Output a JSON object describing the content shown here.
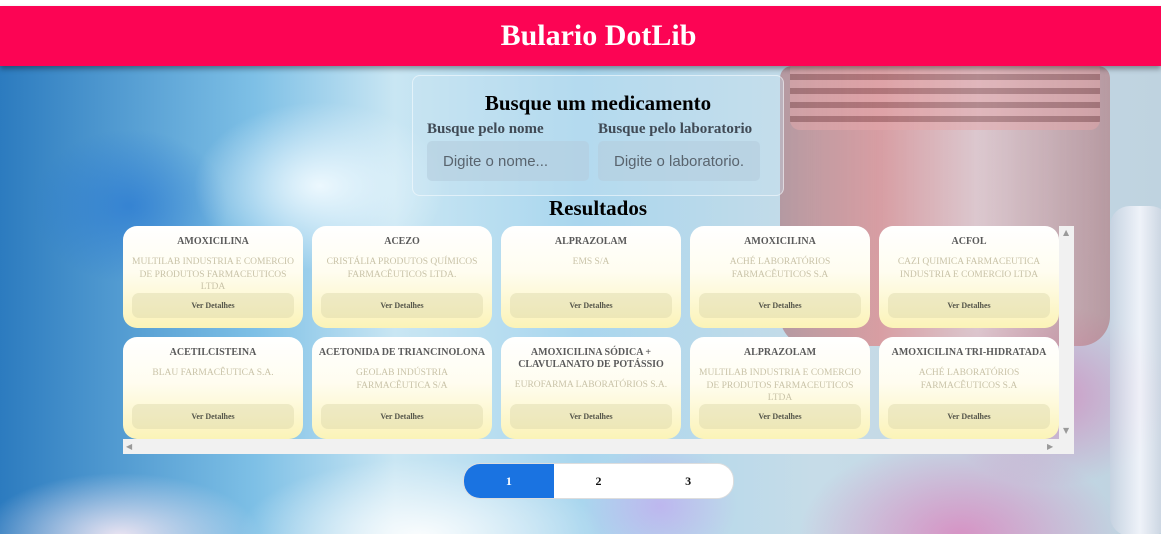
{
  "app": {
    "title": "Bulario DotLib"
  },
  "search": {
    "heading": "Busque um medicamento",
    "name_label": "Busque pelo nome",
    "name_placeholder": "Digite o nome...",
    "lab_label": "Busque pelo laboratorio",
    "lab_placeholder": "Digite o laboratorio..."
  },
  "results": {
    "title": "Resultados",
    "details_label": "Ver Detalhes",
    "cards": [
      {
        "name": "AMOXICILINA",
        "lab": "MULTILAB INDUSTRIA E COMERCIO DE PRODUTOS FARMACEUTICOS LTDA"
      },
      {
        "name": "ACEZO",
        "lab": "CRISTÁLIA PRODUTOS QUÍMICOS FARMACÊUTICOS LTDA."
      },
      {
        "name": "ALPRAZOLAM",
        "lab": "EMS S/A"
      },
      {
        "name": "AMOXICILINA",
        "lab": "ACHÉ LABORATÓRIOS FARMACÊUTICOS S.A"
      },
      {
        "name": "ACFOL",
        "lab": "CAZI QUIMICA FARMACEUTICA INDUSTRIA E COMERCIO LTDA"
      },
      {
        "name": "ACETILCISTEINA",
        "lab": "BLAU FARMACÊUTICA S.A."
      },
      {
        "name": "ACETONIDA DE TRIANCINOLONA",
        "lab": "GEOLAB INDÚSTRIA FARMACÊUTICA S/A"
      },
      {
        "name": "AMOXICILINA SÓDICA + CLAVULANATO DE POTÁSSIO",
        "lab": "EUROFARMA LABORATÓRIOS S.A."
      },
      {
        "name": "ALPRAZOLAM",
        "lab": "MULTILAB INDUSTRIA E COMERCIO DE PRODUTOS FARMACEUTICOS LTDA"
      },
      {
        "name": "AMOXICILINA TRI-HIDRATADA",
        "lab": "ACHÉ LABORATÓRIOS FARMACÊUTICOS S.A"
      }
    ]
  },
  "pagination": {
    "pages": [
      "1",
      "2",
      "3"
    ],
    "current": "1"
  },
  "colors": {
    "header": "#fc0454",
    "active_page": "#1a73e1"
  }
}
